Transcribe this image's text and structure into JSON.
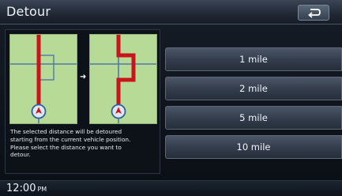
{
  "header": {
    "title": "Detour",
    "back_icon": "return-arrow-icon"
  },
  "panel": {
    "caption_lines": [
      "The selected distance will be detoured",
      "starting from the current vehicle position.",
      "Please select the distance you want to",
      "detour."
    ]
  },
  "options": [
    "1 mile",
    "2 mile",
    "5 mile",
    "10 mile"
  ],
  "footer": {
    "time": "12:00",
    "ampm": "PM"
  },
  "colors": {
    "route": "#c8151b",
    "map_bg": "#b7db96",
    "road": "#4f7aa8",
    "vehicle_ring": "#2d5fa2"
  }
}
